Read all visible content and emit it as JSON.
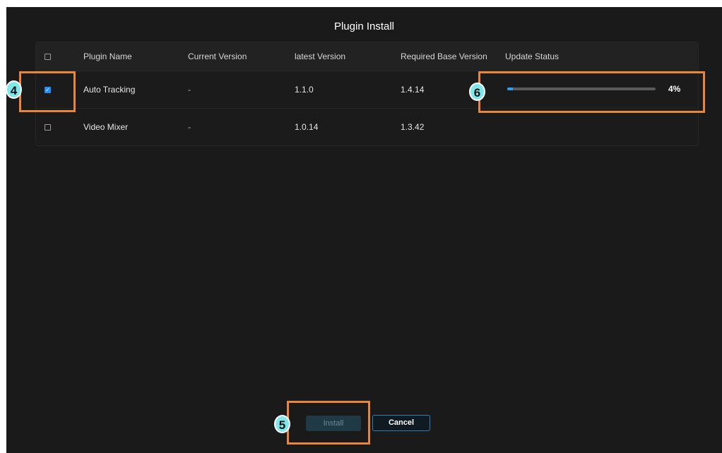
{
  "dialog": {
    "title": "Plugin Install",
    "colors": {
      "background": "#1a1a1a",
      "accent": "#2a9df4",
      "highlight": "#e8873c",
      "badge": "#7fe8e8"
    }
  },
  "table": {
    "columns": [
      "Plugin Name",
      "Current Version",
      "latest Version",
      "Required Base Version",
      "Update Status"
    ],
    "select_all_checked": false,
    "rows": [
      {
        "checked": true,
        "name": "Auto Tracking",
        "current_version": "-",
        "latest_version": "1.1.0",
        "required_base_version": "1.4.14",
        "update_progress": 0.04,
        "update_status": "4%"
      },
      {
        "checked": false,
        "name": "Video Mixer",
        "current_version": "-",
        "latest_version": "1.0.14",
        "required_base_version": "1.3.42",
        "update_status": ""
      }
    ]
  },
  "buttons": {
    "install": "Install",
    "cancel": "Cancel"
  },
  "annotations": {
    "checkbox_callout": "4",
    "install_callout": "5",
    "progress_callout": "6"
  }
}
